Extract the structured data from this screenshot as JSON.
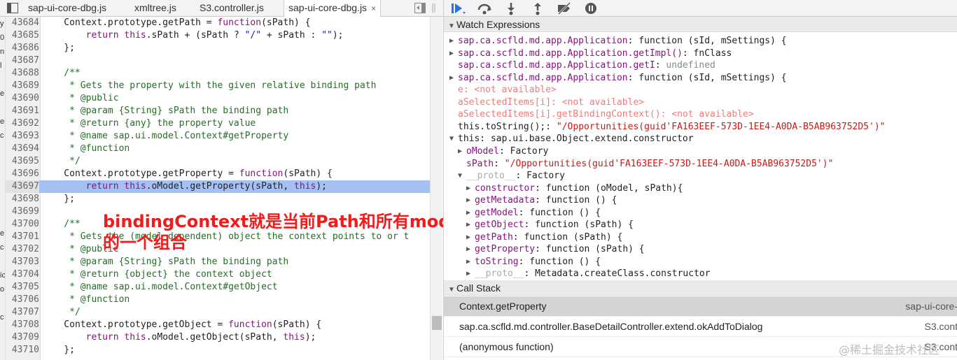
{
  "tabs": [
    {
      "label": "sap-ui-core-dbg.js",
      "active": false
    },
    {
      "label": "xmltree.js",
      "active": false
    },
    {
      "label": "S3.controller.js",
      "active": false
    },
    {
      "label": "sap-ui-core-dbg.js",
      "active": true
    }
  ],
  "tab_close": "×",
  "strip_letters": [
    "y",
    "0",
    "n",
    "l",
    "",
    "e",
    "",
    "er",
    "c",
    "",
    "",
    "",
    "",
    "",
    "",
    "e",
    "c",
    "",
    "ic",
    "o",
    "",
    "c",
    ""
  ],
  "code_lines": [
    {
      "n": "43684",
      "c": [
        [
          "",
          "    Context.prototype.getPath = "
        ],
        [
          "kw",
          "function"
        ],
        [
          "",
          "(sPath) {"
        ]
      ]
    },
    {
      "n": "43685",
      "c": [
        [
          "",
          "        "
        ],
        [
          "kw",
          "return this"
        ],
        [
          "",
          ".sPath + (sPath ? "
        ],
        [
          "st",
          "\"/\""
        ],
        [
          "",
          " + sPath : "
        ],
        [
          "st",
          "\"\""
        ],
        [
          "",
          ");"
        ]
      ]
    },
    {
      "n": "43686",
      "c": [
        [
          "",
          "    };"
        ]
      ]
    },
    {
      "n": "43687",
      "c": [
        [
          "",
          ""
        ]
      ]
    },
    {
      "n": "43688",
      "c": [
        [
          "cm",
          "    /**"
        ]
      ]
    },
    {
      "n": "43689",
      "c": [
        [
          "cm",
          "     * Gets the property with the given relative binding path"
        ]
      ]
    },
    {
      "n": "43690",
      "c": [
        [
          "cm",
          "     * @public"
        ]
      ]
    },
    {
      "n": "43691",
      "c": [
        [
          "cm",
          "     * @param {String} sPath the binding path"
        ]
      ]
    },
    {
      "n": "43692",
      "c": [
        [
          "cm",
          "     * @return {any} the property value"
        ]
      ]
    },
    {
      "n": "43693",
      "c": [
        [
          "cm",
          "     * @name sap.ui.model.Context#getProperty"
        ]
      ]
    },
    {
      "n": "43694",
      "c": [
        [
          "cm",
          "     * @function"
        ]
      ]
    },
    {
      "n": "43695",
      "c": [
        [
          "cm",
          "     */"
        ]
      ]
    },
    {
      "n": "43696",
      "c": [
        [
          "",
          "    Context.prototype.getProperty = "
        ],
        [
          "kw",
          "function"
        ],
        [
          "",
          "(sPath) {"
        ]
      ]
    },
    {
      "n": "43697",
      "c": [
        [
          "",
          "        "
        ],
        [
          "kw",
          "return this"
        ],
        [
          "",
          ".oModel.getProperty(sPath, "
        ],
        [
          "kw",
          "this"
        ],
        [
          "",
          ");"
        ]
      ],
      "hl": true
    },
    {
      "n": "43698",
      "c": [
        [
          "",
          "    };"
        ]
      ]
    },
    {
      "n": "43699",
      "c": [
        [
          "",
          ""
        ]
      ]
    },
    {
      "n": "43700",
      "c": [
        [
          "cm",
          "    /**"
        ]
      ]
    },
    {
      "n": "43701",
      "c": [
        [
          "cm",
          "     * Gets the (model dependent) object the context points to or t"
        ]
      ]
    },
    {
      "n": "43702",
      "c": [
        [
          "cm",
          "     * @public"
        ]
      ]
    },
    {
      "n": "43703",
      "c": [
        [
          "cm",
          "     * @param {String} sPath the binding path"
        ]
      ]
    },
    {
      "n": "43704",
      "c": [
        [
          "cm",
          "     * @return {object} the context object"
        ]
      ]
    },
    {
      "n": "43705",
      "c": [
        [
          "cm",
          "     * @name sap.ui.model.Context#getObject"
        ]
      ]
    },
    {
      "n": "43706",
      "c": [
        [
          "cm",
          "     * @function"
        ]
      ]
    },
    {
      "n": "43707",
      "c": [
        [
          "cm",
          "     */"
        ]
      ]
    },
    {
      "n": "43708",
      "c": [
        [
          "",
          "    Context.prototype.getObject = "
        ],
        [
          "kw",
          "function"
        ],
        [
          "",
          "(sPath) {"
        ]
      ]
    },
    {
      "n": "43709",
      "c": [
        [
          "",
          "        "
        ],
        [
          "kw",
          "return this"
        ],
        [
          "",
          ".oModel.getObject(sPath, "
        ],
        [
          "kw",
          "this"
        ],
        [
          "",
          ");"
        ]
      ]
    },
    {
      "n": "43710",
      "c": [
        [
          "",
          "    };"
        ]
      ]
    }
  ],
  "annotation": "bindingContext就是当前Path和所有model集合的一个组合",
  "watch": {
    "title": "Watch Expressions",
    "rows": [
      {
        "ind": 0,
        "tri": "▶",
        "p": [
          [
            "name",
            "sap.ca.scfld.md.app.Application"
          ],
          [
            "val",
            ": function (sId, mSettings) {"
          ]
        ]
      },
      {
        "ind": 0,
        "tri": "▶",
        "p": [
          [
            "name",
            "sap.ca.scfld.md.app.Application.getImpl()"
          ],
          [
            "val",
            ": fnClass"
          ]
        ]
      },
      {
        "ind": 0,
        "tri": "",
        "p": [
          [
            "name",
            "sap.ca.scfld.md.app.Application.getI"
          ],
          [
            "val",
            ": "
          ],
          [
            "undef",
            "undefined"
          ]
        ]
      },
      {
        "ind": 0,
        "tri": "▶",
        "p": [
          [
            "name",
            "sap.ca.scfld.md.app.Application"
          ],
          [
            "val",
            ": function (sId, mSettings) {"
          ]
        ]
      },
      {
        "ind": 0,
        "tri": "",
        "p": [
          [
            "na",
            "e: <not available>"
          ]
        ]
      },
      {
        "ind": 0,
        "tri": "",
        "p": [
          [
            "na",
            "aSelectedItems[i]: <not available>"
          ]
        ]
      },
      {
        "ind": 0,
        "tri": "",
        "p": [
          [
            "na",
            "aSelectedItems[i].getBindingContext(): <not available>"
          ]
        ]
      },
      {
        "ind": 0,
        "tri": "",
        "p": [
          [
            "val",
            "this.toString();: "
          ],
          [
            "strv",
            "\"/Opportunities(guid'FA163EEF-573D-1EE4-A0DA-B5AB963752D5')\""
          ]
        ]
      },
      {
        "ind": 0,
        "tri": "▼",
        "p": [
          [
            "val",
            "this: sap.ui.base.Object.extend.constructor"
          ]
        ]
      },
      {
        "ind": 1,
        "tri": "▶",
        "p": [
          [
            "name",
            "oModel"
          ],
          [
            "val",
            ": Factory"
          ]
        ]
      },
      {
        "ind": 1,
        "tri": "",
        "p": [
          [
            "name",
            "sPath"
          ],
          [
            "val",
            ": "
          ],
          [
            "strv",
            "\"/Opportunities(guid'FA163EEF-573D-1EE4-A0DA-B5AB963752D5')\""
          ]
        ]
      },
      {
        "ind": 1,
        "tri": "▼",
        "p": [
          [
            "grey",
            "__proto__"
          ],
          [
            "val",
            ": Factory"
          ]
        ]
      },
      {
        "ind": 2,
        "tri": "▶",
        "p": [
          [
            "name",
            "constructor"
          ],
          [
            "val",
            ": function (oModel, sPath){"
          ]
        ]
      },
      {
        "ind": 2,
        "tri": "▶",
        "p": [
          [
            "name",
            "getMetadata"
          ],
          [
            "val",
            ": function () {"
          ]
        ]
      },
      {
        "ind": 2,
        "tri": "▶",
        "p": [
          [
            "name",
            "getModel"
          ],
          [
            "val",
            ": function () {"
          ]
        ]
      },
      {
        "ind": 2,
        "tri": "▶",
        "p": [
          [
            "name",
            "getObject"
          ],
          [
            "val",
            ": function (sPath) {"
          ]
        ]
      },
      {
        "ind": 2,
        "tri": "▶",
        "p": [
          [
            "name",
            "getPath"
          ],
          [
            "val",
            ": function (sPath) {"
          ]
        ]
      },
      {
        "ind": 2,
        "tri": "▶",
        "p": [
          [
            "name",
            "getProperty"
          ],
          [
            "val",
            ": function (sPath) {"
          ]
        ]
      },
      {
        "ind": 2,
        "tri": "▶",
        "p": [
          [
            "name",
            "toString"
          ],
          [
            "val",
            ": function () {"
          ]
        ]
      },
      {
        "ind": 2,
        "tri": "▶",
        "p": [
          [
            "grey",
            "__proto__"
          ],
          [
            "val",
            ": Metadata.createClass.constructor"
          ]
        ]
      }
    ]
  },
  "callstack": {
    "title": "Call Stack",
    "frames": [
      {
        "fn": "Context.getProperty",
        "loc": "sap-ui-core-",
        "sel": true
      },
      {
        "fn": "sap.ca.scfld.md.controller.BaseDetailController.extend.okAddToDialog",
        "loc": "S3.cont",
        "sel": false
      },
      {
        "fn": "(anonymous function)",
        "loc": "S3.cont",
        "sel": false
      }
    ]
  },
  "watermark": "@稀土掘金技术社区",
  "icons": {
    "nav_toggle": "sidebar-toggle-icon",
    "split": "panel-split-icon",
    "resume": "resume-icon",
    "step_over": "step-over-icon",
    "step_into": "step-into-icon",
    "step_out": "step-out-icon",
    "deactivate": "deactivate-breakpoints-icon",
    "pause_exceptions": "pause-on-exceptions-icon"
  }
}
